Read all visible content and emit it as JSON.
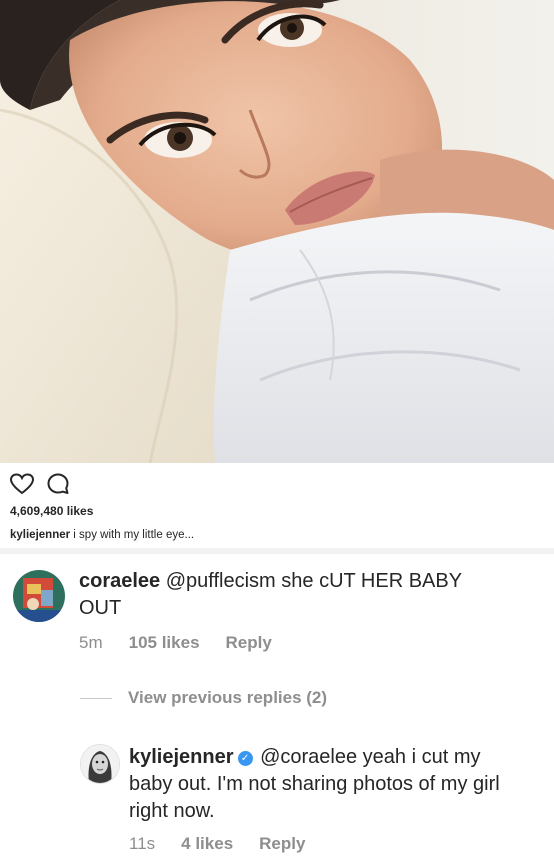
{
  "post": {
    "likes": "4,609,480 likes",
    "caption_user": "kyliejenner",
    "caption_text": "i spy with my little eye..."
  },
  "actions": {
    "like_icon": "heart-icon",
    "comment_icon": "comment-bubble-icon"
  },
  "comments": [
    {
      "user": "coraelee",
      "text": "@pufflecism she cUT HER BABY OUT",
      "text_line1": "@pufflecism she cUT HER BABY",
      "text_line2": "OUT",
      "time": "5m",
      "likes": "105 likes",
      "reply": "Reply"
    }
  ],
  "view_previous": "View previous replies (2)",
  "reply_comment": {
    "user": "kyliejenner",
    "verified": true,
    "line1": "@coraelee yeah i cut my",
    "line2": "baby out. I'm not sharing photos of my girl",
    "line3": "right now.",
    "time": "11s",
    "likes": "4 likes",
    "reply": "Reply"
  },
  "colors": {
    "text": "#262626",
    "muted": "#8e8e8e",
    "verified": "#3897f0"
  }
}
